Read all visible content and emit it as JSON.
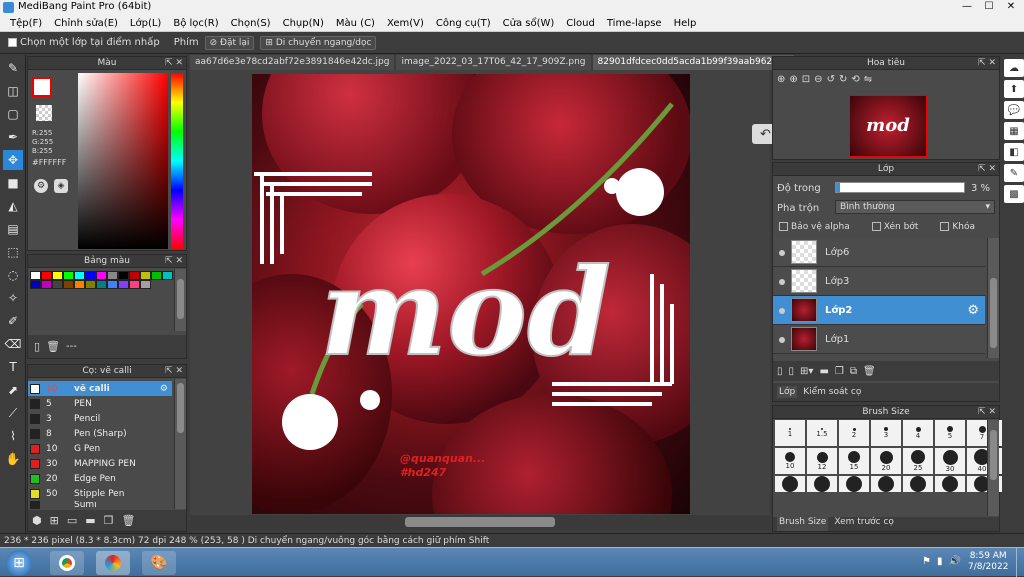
{
  "window": {
    "title": "MediBang Paint Pro (64bit)",
    "min": "—",
    "max": "☐",
    "close": "✕"
  },
  "menu": [
    "Tệp(F)",
    "Chỉnh sửa(E)",
    "Lớp(L)",
    "Bộ lọc(R)",
    "Chọn(S)",
    "Chụp(N)",
    "Màu (C)",
    "Xem(V)",
    "Công cụ(T)",
    "Cửa sổ(W)",
    "Cloud",
    "Time-lapse",
    "Help"
  ],
  "options": {
    "select_layer": "Chọn một lớp tại điểm nhấp",
    "key_label": "Phím",
    "reset": "Đặt lại",
    "move": "Di chuyển ngang/dọc"
  },
  "tabs": [
    "aa67d6e3e78cd2abf72e3891846e42dc.jpg",
    "image_2022_03_17T06_42_17_909Z.png",
    "82901dfdcec0dd5acda1b99f39aab962.jpg"
  ],
  "color_panel": {
    "title": "Màu",
    "r": "R:255",
    "g": "G:255",
    "b": "B:255",
    "hex": "#FFFFFF"
  },
  "palette_panel": {
    "title": "Bảng màu",
    "footer": "---",
    "colors": [
      "#ffffff",
      "#ff0000",
      "#ffff00",
      "#00ff00",
      "#00ffff",
      "#0000ff",
      "#ff00ff",
      "#888888",
      "#000000",
      "#c00000",
      "#c0c000",
      "#00c000",
      "#00c0c0",
      "#0000c0",
      "#c000c0",
      "#444444",
      "#804000",
      "#ff8000",
      "#808000",
      "#008080",
      "#4080ff",
      "#8040ff",
      "#ff4080",
      "#a0a0a0"
    ]
  },
  "brush_panel": {
    "title": "Cọ: vẽ calli",
    "items": [
      {
        "size": "10",
        "name": "vẽ calli",
        "color": "#ffffff",
        "selected": true
      },
      {
        "size": "5",
        "name": "PEN",
        "color": "#222222"
      },
      {
        "size": "3",
        "name": "Pencil",
        "color": "#222222"
      },
      {
        "size": "8",
        "name": "Pen (Sharp)",
        "color": "#222222"
      },
      {
        "size": "10",
        "name": "G Pen",
        "color": "#e02020"
      },
      {
        "size": "30",
        "name": "MAPPING PEN",
        "color": "#e02020"
      },
      {
        "size": "20",
        "name": "Edge Pen",
        "color": "#20c020"
      },
      {
        "size": "50",
        "name": "Stipple Pen",
        "color": "#e0e020"
      },
      {
        "size": "",
        "name": "Sumi",
        "color": "#222222"
      }
    ]
  },
  "canvas": {
    "watermark1": "@quanquan...",
    "watermark2": "#hd247",
    "art_text": "mod"
  },
  "navigator": {
    "title": "Hoa tiêu"
  },
  "layer_panel": {
    "title": "Lớp",
    "opacity_label": "Độ trong",
    "opacity_value": "3 %",
    "opacity": 0.03,
    "blend_label": "Pha trộn",
    "blend_value": "Bình thường",
    "protect_alpha": "Bảo vệ alpha",
    "clip": "Xén bớt",
    "lock": "Khóa",
    "layers": [
      {
        "name": "Lớp6",
        "type": "empty",
        "selected": false
      },
      {
        "name": "Lớp3",
        "type": "empty",
        "selected": false
      },
      {
        "name": "Lớp2",
        "type": "art",
        "selected": true
      },
      {
        "name": "Lớp1",
        "type": "art",
        "selected": false
      }
    ],
    "tab_layer": "Lớp",
    "tab_control": "Kiểm soát cọ"
  },
  "brush_size": {
    "title": "Brush Size",
    "rows": [
      [
        "1",
        "1.5",
        "2",
        "3",
        "4",
        "5",
        "7",
        ""
      ],
      [
        "10",
        "12",
        "15",
        "20",
        "25",
        "30",
        "40",
        ""
      ],
      [
        "",
        "",
        "",
        "",
        "",
        "",
        "",
        ""
      ]
    ],
    "tab1": "Brush Size",
    "tab2": "Xem trước cọ"
  },
  "status": {
    "text": "236 * 236 pixel   (8.3 * 8.3cm)   72 dpi   248 %   (253, 58 )   Di chuyển ngang/vuông góc bằng cách giữ phím Shift"
  },
  "taskbar": {
    "time": "8:59 AM",
    "date": "7/8/2022"
  }
}
